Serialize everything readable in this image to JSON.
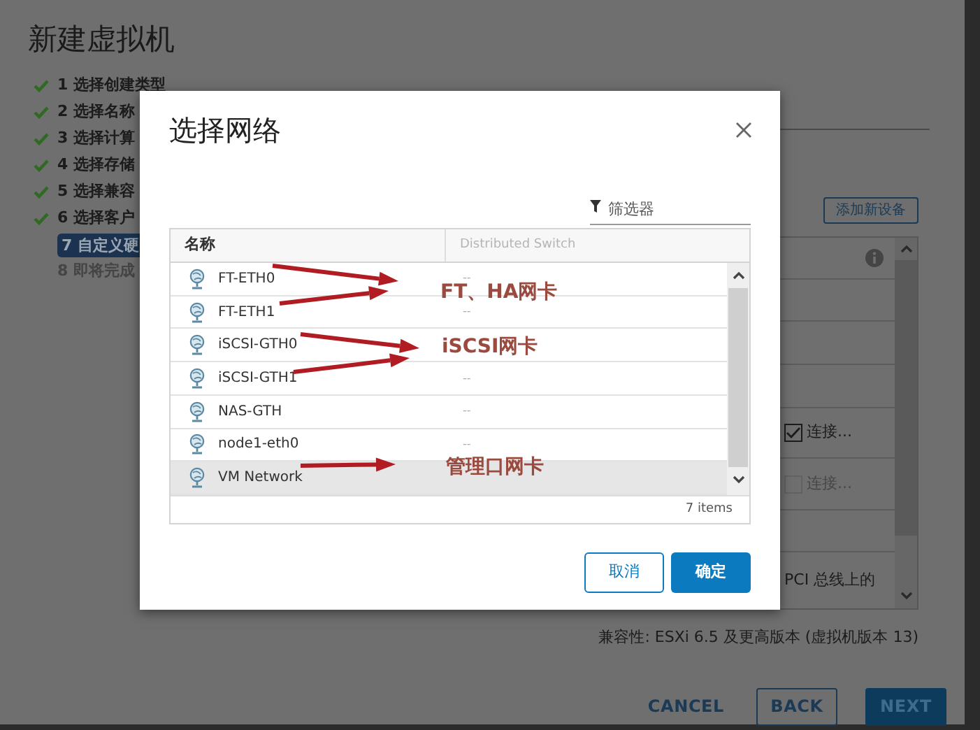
{
  "wizard": {
    "title": "新建虚拟机",
    "steps": [
      {
        "label": "1 选择创建类型",
        "done": true,
        "selected": false
      },
      {
        "label": "2 选择名称",
        "done": true,
        "selected": false
      },
      {
        "label": "3 选择计算",
        "done": true,
        "selected": false
      },
      {
        "label": "4 选择存储",
        "done": true,
        "selected": false
      },
      {
        "label": "5 选择兼容",
        "done": true,
        "selected": false
      },
      {
        "label": "6 选择客户",
        "done": true,
        "selected": false
      },
      {
        "label": "7 自定义硬",
        "done": false,
        "selected": true
      },
      {
        "label": "8 即将完成",
        "done": false,
        "selected": false
      }
    ],
    "add_device_button": "添加新设备",
    "device_rows": [
      {
        "kind": "info"
      },
      {
        "kind": "blank"
      },
      {
        "kind": "blank"
      },
      {
        "kind": "blank"
      },
      {
        "kind": "checkbox",
        "label": "连接...",
        "checked": true,
        "disabled": false
      },
      {
        "kind": "checkbox",
        "label": "连接...",
        "checked": false,
        "disabled": true
      },
      {
        "kind": "blank"
      },
      {
        "kind": "text",
        "text": "PCI 总线上的"
      }
    ],
    "compatibility": "兼容性: ESXi 6.5 及更高版本 (虚拟机版本 13)",
    "buttons": [
      {
        "label": "CANCEL",
        "kind": "link"
      },
      {
        "label": "BACK",
        "kind": "outline"
      },
      {
        "label": "NEXT",
        "kind": "primary"
      }
    ]
  },
  "dialog": {
    "title": "选择网络",
    "filter": {
      "placeholder": "筛选器"
    },
    "table": {
      "columns": [
        "名称",
        "Distributed Switch"
      ],
      "rows": [
        {
          "name": "FT-ETH0",
          "switch": "--",
          "selected": false
        },
        {
          "name": "FT-ETH1",
          "switch": "--",
          "selected": false
        },
        {
          "name": "iSCSI-GTH0",
          "selected": false
        },
        {
          "name": "iSCSI-GTH1",
          "switch": "--",
          "selected": false
        },
        {
          "name": "NAS-GTH",
          "switch": "--",
          "selected": false
        },
        {
          "name": "node1-eth0",
          "switch": "--",
          "selected": false
        },
        {
          "name": "VM Network",
          "selected": true
        }
      ],
      "footer": "7 items"
    },
    "buttons": [
      {
        "label": "取消",
        "kind": "secondary"
      },
      {
        "label": "确定",
        "kind": "primary"
      }
    ]
  },
  "annotations": [
    {
      "text": "FT、HA网卡"
    },
    {
      "text": "iSCSI网卡"
    },
    {
      "text": "管理口网卡"
    }
  ]
}
